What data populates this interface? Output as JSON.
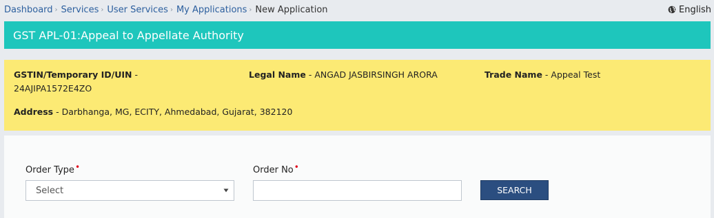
{
  "breadcrumb": {
    "items": [
      "Dashboard",
      "Services",
      "User Services",
      "My Applications"
    ],
    "current": "New Application"
  },
  "language": {
    "icon": "globe-icon",
    "label": "English"
  },
  "title": "GST APL-01:Appeal to Appellate Authority",
  "taxpayer": {
    "gstin_label": "GSTIN/Temporary ID/UIN",
    "gstin_value": "24AJIPA1572E4ZO",
    "legal_name_label": "Legal Name",
    "legal_name_value": "ANGAD JASBIRSINGH ARORA",
    "trade_name_label": "Trade Name",
    "trade_name_value": "Appeal Test",
    "address_label": "Address",
    "address_value": "Darbhanga, MG, ECITY, Ahmedabad, Gujarat, 382120"
  },
  "form": {
    "order_type_label": "Order Type",
    "order_type_value": "Select",
    "order_no_label": "Order No",
    "order_no_value": "",
    "required_mark": "•",
    "search_label": "SEARCH"
  },
  "colors": {
    "title_bar": "#1ec6bc",
    "info_box": "#fcea74",
    "search_button": "#2b4e80",
    "link": "#2c5f9e",
    "required": "#e0001a"
  }
}
